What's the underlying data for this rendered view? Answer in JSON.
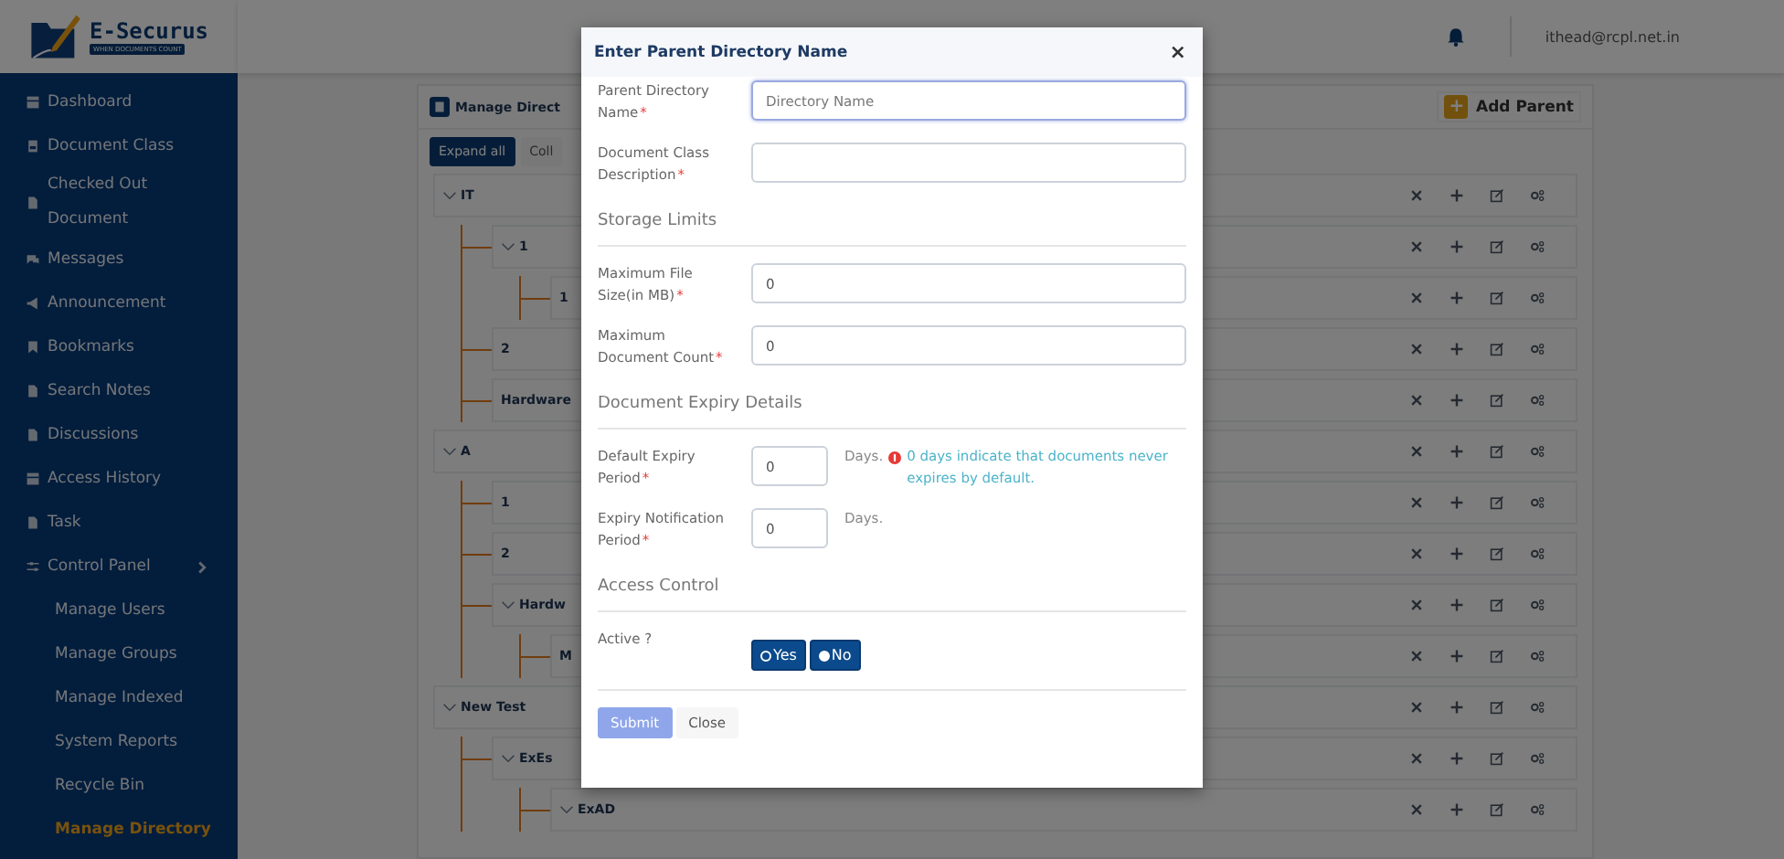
{
  "logo": {
    "name": "E-Securus",
    "tagline": "WHEN DOCUMENTS COUNT"
  },
  "sidebar": {
    "items": [
      {
        "label": "Dashboard",
        "selected": false
      },
      {
        "label": "Document Class",
        "selected": false
      },
      {
        "label": "Checked Out Document",
        "selected": false
      },
      {
        "label": "Messages",
        "selected": false
      },
      {
        "label": "Announcement",
        "selected": false
      },
      {
        "label": "Bookmarks",
        "selected": false
      },
      {
        "label": "Search Notes",
        "selected": false
      },
      {
        "label": "Discussions",
        "selected": false
      },
      {
        "label": "Access History",
        "selected": false
      },
      {
        "label": "Task",
        "selected": false
      },
      {
        "label": "Control Panel",
        "selected": false,
        "children": [
          {
            "label": "Manage Users",
            "selected": false
          },
          {
            "label": "Manage Groups",
            "selected": false
          },
          {
            "label": "Manage Indexed",
            "selected": false
          },
          {
            "label": "System Reports",
            "selected": false
          },
          {
            "label": "Recycle Bin",
            "selected": false
          },
          {
            "label": "Manage Directory",
            "selected": true
          }
        ]
      }
    ]
  },
  "header": {
    "user": "ithead@rcpl.net.in"
  },
  "panel": {
    "title": "Manage Direct",
    "add_button": "Add Parent",
    "add_icon": "+",
    "toolbar": [
      "Expand all",
      "Coll"
    ],
    "tree": [
      {
        "label": "IT",
        "expanded": true,
        "children": [
          {
            "label": "1",
            "expanded": true,
            "children": [
              {
                "label": "1"
              }
            ]
          },
          {
            "label": "2"
          },
          {
            "label": "Hardware"
          }
        ]
      },
      {
        "label": "A",
        "expanded": true,
        "children": [
          {
            "label": "1"
          },
          {
            "label": "2"
          },
          {
            "label": "Hardw",
            "expanded": true,
            "children": [
              {
                "label": "M"
              }
            ]
          }
        ]
      },
      {
        "label": "New Test",
        "expanded": true,
        "children": [
          {
            "label": "ExEs",
            "expanded": true,
            "children": [
              {
                "label": "ExAD",
                "expanded": true
              }
            ]
          }
        ]
      }
    ]
  },
  "modal": {
    "title": "Enter Parent Directory Name",
    "close": "×",
    "rows": [
      {
        "kind": "text",
        "label": "Parent Directory Name",
        "mark": "*",
        "placeholder": "Directory Name",
        "focused": true
      },
      {
        "kind": "text",
        "label": "Document Class Description",
        "mark": "*",
        "focused": false
      },
      {
        "kind": "heading",
        "text": "Storage Limits"
      },
      {
        "kind": "text",
        "label": "Maximum File Size(in MB)",
        "mark": "*",
        "value": "0",
        "focused": false
      },
      {
        "kind": "text",
        "label": "Maximum Document Count",
        "mark": "*",
        "value": "0",
        "focused": false
      },
      {
        "kind": "heading",
        "text": "Document Expiry Details"
      },
      {
        "kind": "number",
        "label": "Default Expiry Period",
        "mark": "*",
        "value": "0",
        "unit": "Days.",
        "note": "0 days indicate that documents never expires by default."
      },
      {
        "kind": "number",
        "label": "Expiry Notification Period",
        "mark": "*",
        "value": "0",
        "unit": "Days."
      },
      {
        "kind": "heading",
        "text": "Access Control"
      },
      {
        "kind": "toggle",
        "label": "Active ?",
        "options": [
          {
            "label": "Yes",
            "selected": false
          },
          {
            "label": "No",
            "selected": true
          }
        ]
      }
    ],
    "buttons": [
      {
        "label": "Submit",
        "kind": "primary",
        "disabled": true
      },
      {
        "label": "Close",
        "kind": "plain",
        "disabled": false
      }
    ]
  }
}
